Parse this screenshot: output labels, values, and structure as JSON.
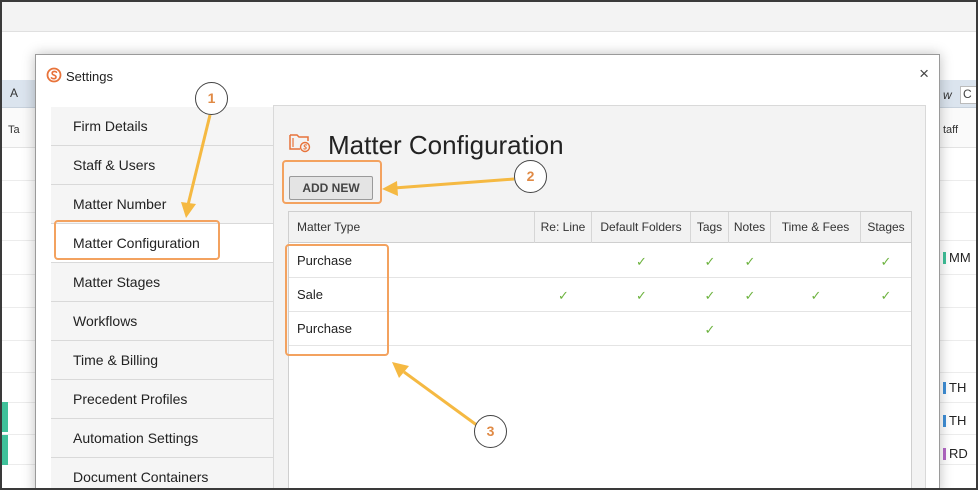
{
  "background": {
    "left_tab_fragment": "A",
    "left_header_fragment": "Ta",
    "right_tab_fragment": "w",
    "right_input_fragment": "C",
    "right_header_fragment": "taff",
    "right_initials": [
      "MM",
      "TH",
      "TH",
      "RD"
    ]
  },
  "dialog": {
    "title": "Settings",
    "close_label": "×",
    "nav": [
      {
        "label": "Firm Details"
      },
      {
        "label": "Staff & Users"
      },
      {
        "label": "Matter Number"
      },
      {
        "label": "Matter Configuration"
      },
      {
        "label": "Matter Stages"
      },
      {
        "label": "Workflows"
      },
      {
        "label": "Time & Billing"
      },
      {
        "label": "Precedent Profiles"
      },
      {
        "label": "Automation Settings"
      },
      {
        "label": "Document Containers"
      }
    ],
    "active_nav": "Matter Configuration",
    "page_title": "Matter Configuration",
    "add_button_label": "ADD NEW",
    "table": {
      "columns": [
        "Matter Type",
        "Re: Line",
        "Default Folders",
        "Tags",
        "Notes",
        "Time & Fees",
        "Stages"
      ],
      "check_glyph": "✓",
      "rows": [
        {
          "matter_type": "Purchase",
          "re_line": false,
          "default_folders": true,
          "tags": true,
          "notes": true,
          "time_fees": false,
          "stages": true
        },
        {
          "matter_type": "Sale",
          "re_line": true,
          "default_folders": true,
          "tags": true,
          "notes": true,
          "time_fees": true,
          "stages": true
        },
        {
          "matter_type": "Purchase",
          "re_line": false,
          "default_folders": false,
          "tags": true,
          "notes": false,
          "time_fees": false,
          "stages": false
        }
      ]
    }
  },
  "annotations": [
    {
      "label": "1"
    },
    {
      "label": "2"
    },
    {
      "label": "3"
    }
  ],
  "colors": {
    "accent_orange": "#f3a25f",
    "check_green": "#6db33f",
    "brand_orange": "#e8733a"
  }
}
